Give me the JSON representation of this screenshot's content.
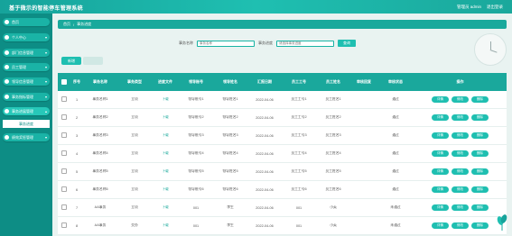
{
  "header": {
    "title": "基于微示的智能停车管理系统",
    "user": "管理员 admin",
    "logout": "退出登录"
  },
  "sidebar": {
    "items": [
      {
        "label": "首页"
      },
      {
        "label": "个人中心"
      },
      {
        "label": "部门信息管理"
      },
      {
        "label": "员工管理"
      },
      {
        "label": "领导信息管理"
      },
      {
        "label": "事务指标管理"
      },
      {
        "label": "事务进展管理"
      },
      {
        "label": "事务进度"
      },
      {
        "label": "绩效奖惩管理"
      }
    ]
  },
  "breadcrumb": {
    "home": "首页",
    "sep": "/",
    "current": "事务进度"
  },
  "search": {
    "label1": "事务名称",
    "placeholder1": "事务名称",
    "label2": "事务进度",
    "placeholder2": "请选择事务进度",
    "button": "查询"
  },
  "toolbar": {
    "add": "新增"
  },
  "table": {
    "headers": [
      "序号",
      "事务名称",
      "事务类型",
      "进度文件",
      "领导账号",
      "领导姓名",
      "汇报日期",
      "员工工号",
      "员工姓名",
      "审核回复",
      "审核状态",
      "操作"
    ],
    "rows": [
      {
        "no": "1",
        "name": "事务名称1",
        "type": "立项",
        "file": "下载",
        "lacc": "领导账号1",
        "lname": "领导姓名1",
        "date": "2022-04-06",
        "eno": "员工工号1",
        "ename": "员工姓名1",
        "reply": "",
        "status": "通过"
      },
      {
        "no": "2",
        "name": "事务名称2",
        "type": "立项",
        "file": "下载",
        "lacc": "领导账号2",
        "lname": "领导姓名2",
        "date": "2022-04-06",
        "eno": "员工工号2",
        "ename": "员工姓名2",
        "reply": "",
        "status": "通过"
      },
      {
        "no": "3",
        "name": "事务名称3",
        "type": "立项",
        "file": "下载",
        "lacc": "领导账号3",
        "lname": "领导姓名3",
        "date": "2022-04-06",
        "eno": "员工工号3",
        "ename": "员工姓名3",
        "reply": "",
        "status": "通过"
      },
      {
        "no": "4",
        "name": "事务名称4",
        "type": "立项",
        "file": "下载",
        "lacc": "领导账号4",
        "lname": "领导姓名4",
        "date": "2022-04-06",
        "eno": "员工工号4",
        "ename": "员工姓名4",
        "reply": "",
        "status": "通过"
      },
      {
        "no": "5",
        "name": "事务名称5",
        "type": "立项",
        "file": "下载",
        "lacc": "领导账号5",
        "lname": "领导姓名5",
        "date": "2022-04-06",
        "eno": "员工工号5",
        "ename": "员工姓名5",
        "reply": "",
        "status": "通过"
      },
      {
        "no": "6",
        "name": "事务名称6",
        "type": "立项",
        "file": "下载",
        "lacc": "领导账号6",
        "lname": "领导姓名6",
        "date": "2022-04-06",
        "eno": "员工工号6",
        "ename": "员工姓名6",
        "reply": "",
        "status": "通过"
      },
      {
        "no": "7",
        "name": "AA事务",
        "type": "立项",
        "file": "下载",
        "lacc": "001",
        "lname": "李生",
        "date": "2022-04-06",
        "eno": "001",
        "ename": "小英",
        "reply": "",
        "status": "未通过"
      },
      {
        "no": "8",
        "name": "AA事务",
        "type": "交办",
        "file": "下载",
        "lacc": "001",
        "lname": "李生",
        "date": "2022-04-06",
        "eno": "001",
        "ename": "小英",
        "reply": "",
        "status": "未通过"
      }
    ],
    "actions": {
      "detail": "详情",
      "edit": "修改",
      "delete": "删除"
    }
  }
}
